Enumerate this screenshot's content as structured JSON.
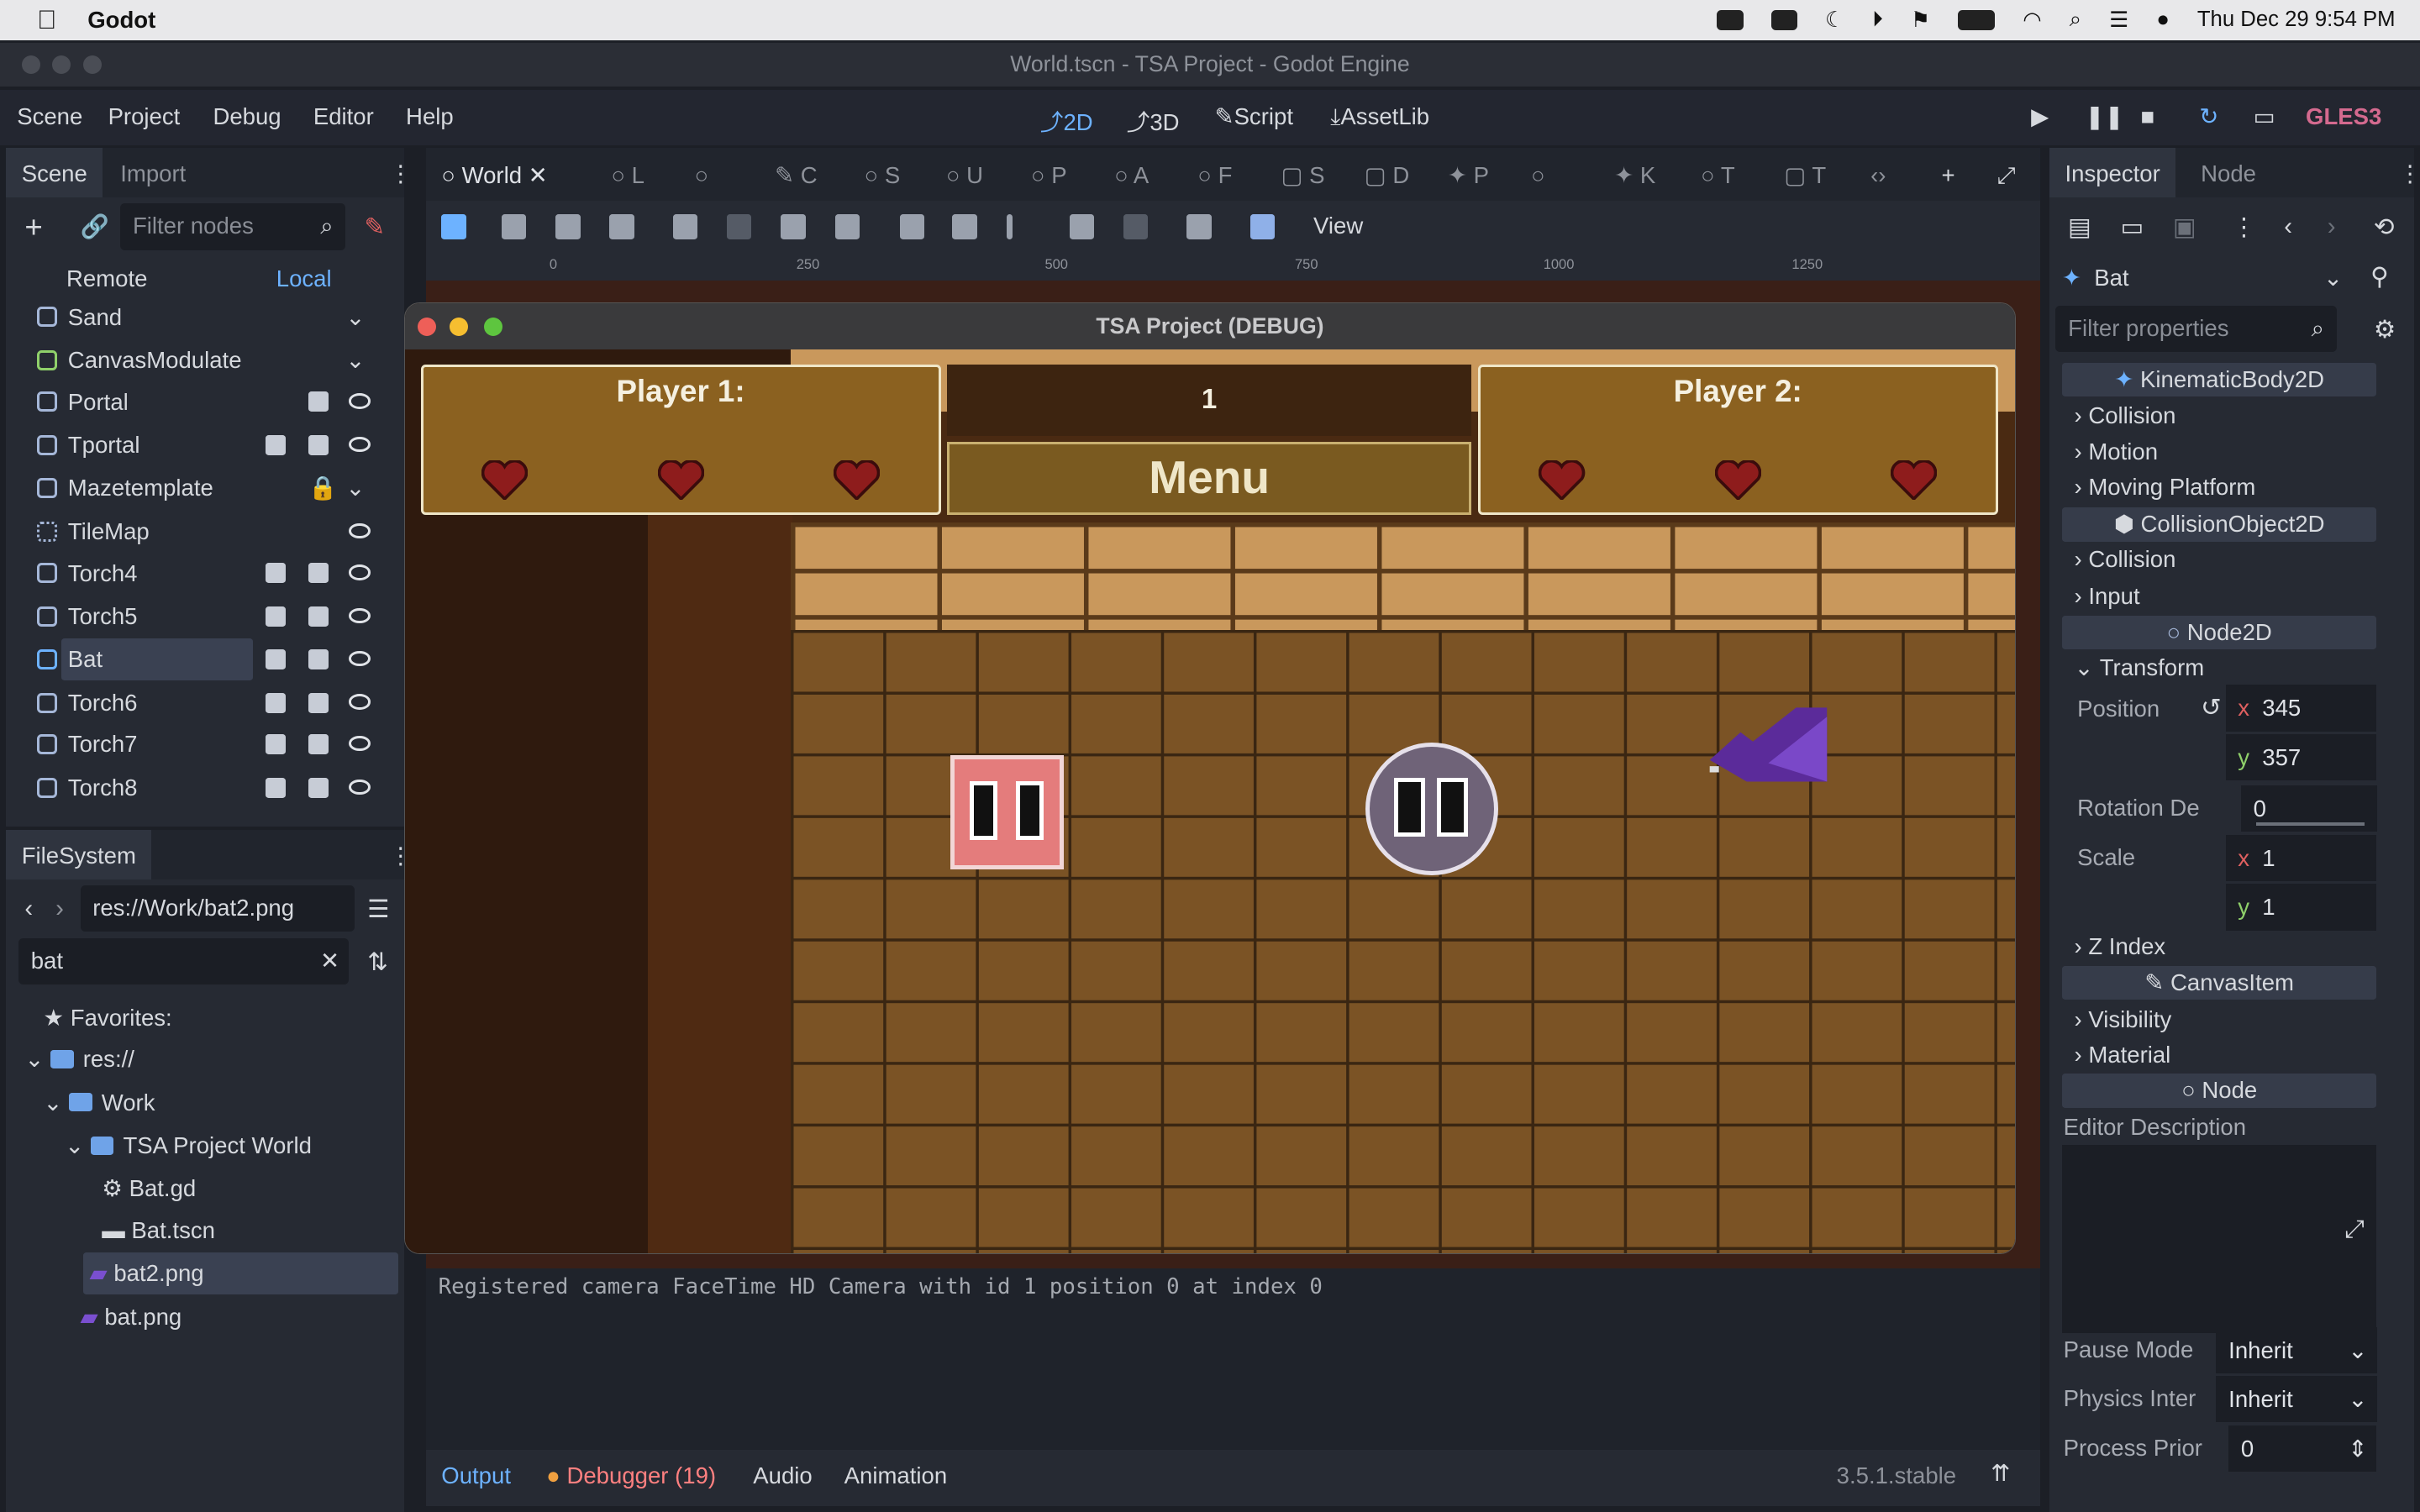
{
  "menubar": {
    "app": "Godot",
    "datetime": "Thu Dec 29  9:54 PM"
  },
  "window": {
    "title": "World.tscn - TSA Project - Godot Engine"
  },
  "main_menu": [
    "Scene",
    "Project",
    "Debug",
    "Editor",
    "Help"
  ],
  "workspaces": [
    {
      "label": "2D"
    },
    {
      "label": "3D"
    },
    {
      "label": "Script"
    },
    {
      "label": "AssetLib"
    }
  ],
  "renderer": "GLES3",
  "left_dock": {
    "tabs": [
      "Scene",
      "Import"
    ],
    "filter_placeholder": "Filter nodes",
    "remote": "Remote",
    "local": "Local"
  },
  "scene_tree": [
    {
      "name": "Sand"
    },
    {
      "name": "CanvasModulate"
    },
    {
      "name": "Portal"
    },
    {
      "name": "Tportal"
    },
    {
      "name": "Mazetemplate"
    },
    {
      "name": "TileMap"
    },
    {
      "name": "Torch4"
    },
    {
      "name": "Torch5"
    },
    {
      "name": "Bat",
      "selected": true
    },
    {
      "name": "Torch6"
    },
    {
      "name": "Torch7"
    },
    {
      "name": "Torch8"
    }
  ],
  "filesystem": {
    "tab": "FileSystem",
    "path": "res://Work/bat2.png",
    "search": "bat",
    "items": [
      "Favorites:",
      "res://",
      "Work",
      "TSA Project World",
      "Bat.gd",
      "Bat.tscn",
      "bat2.png",
      "bat.png"
    ]
  },
  "scene_tabs": [
    "World",
    "L",
    "",
    "C",
    "S",
    "U",
    "P",
    "A",
    "F",
    "S",
    "D",
    "P",
    "",
    "K",
    "T",
    "T"
  ],
  "toolbar": {
    "view": "View"
  },
  "ruler": [
    "0",
    "250",
    "500",
    "750",
    "1000",
    "1250"
  ],
  "game": {
    "title": "TSA Project (DEBUG)",
    "player1": "Player 1:",
    "player2": "Player 2:",
    "counter": "1",
    "menu": "Menu"
  },
  "output": {
    "line": "Registered camera FaceTime HD Camera with id 1 position 0 at index 0"
  },
  "bottom": {
    "tabs": [
      "Output",
      "Debugger (19)",
      "Audio",
      "Animation"
    ],
    "version": "3.5.1.stable"
  },
  "inspector": {
    "tabs": [
      "Inspector",
      "Node"
    ],
    "node": "Bat",
    "filter_placeholder": "Filter properties",
    "sections": [
      "KinematicBody2D",
      "CollisionObject2D",
      "Node2D",
      "CanvasItem",
      "Node"
    ],
    "kb_props": [
      "Collision",
      "Motion",
      "Moving Platform"
    ],
    "co_props": [
      "Collision",
      "Input"
    ],
    "transform": "Transform",
    "position_label": "Position",
    "pos_x": "345",
    "pos_y": "357",
    "rotation_label": "Rotation De",
    "rotation": "0",
    "scale_label": "Scale",
    "scale_x": "1",
    "scale_y": "1",
    "z_index": "Z Index",
    "visibility": "Visibility",
    "material": "Material",
    "editor_description": "Editor Description",
    "pause_mode_label": "Pause Mode",
    "pause_mode": "Inherit",
    "physics_label": "Physics Inter",
    "physics": "Inherit",
    "priority_label": "Process Prior",
    "priority": "0"
  }
}
